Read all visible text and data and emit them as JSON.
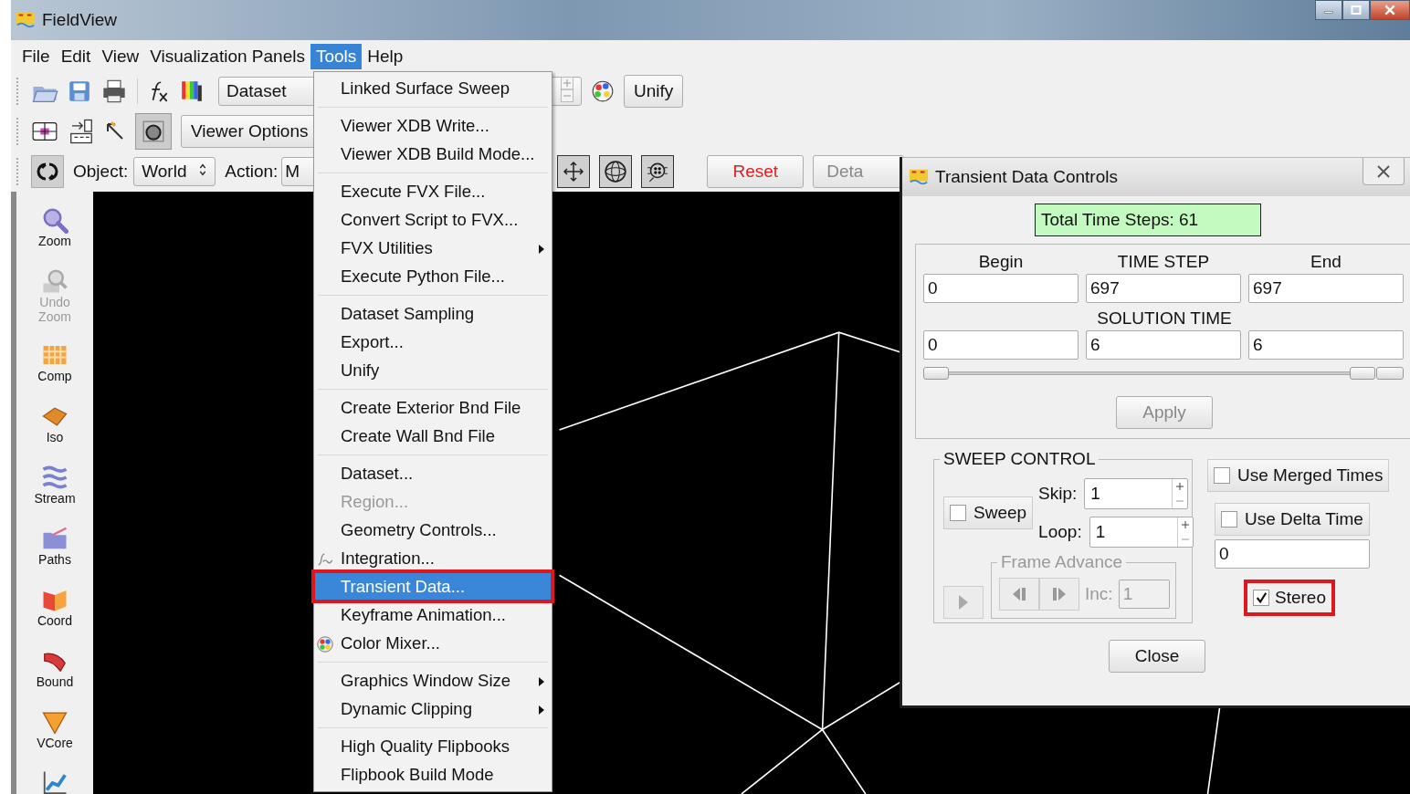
{
  "window": {
    "title": "FieldView"
  },
  "menubar": [
    {
      "label": "File",
      "selected": false
    },
    {
      "label": "Edit",
      "selected": false
    },
    {
      "label": "View",
      "selected": false
    },
    {
      "label": "Visualization Panels",
      "selected": false
    },
    {
      "label": "Tools",
      "selected": true
    },
    {
      "label": "Help",
      "selected": false
    }
  ],
  "toolbar_1": {
    "dataset_select": "Dataset",
    "unify_button": "Unify"
  },
  "toolbar_2": {
    "viewer_options_button": "Viewer Options"
  },
  "toolbar_3": {
    "object_label": "Object:",
    "object_value": "World",
    "action_label": "Action:",
    "action_value": "M",
    "reset_button": "Reset",
    "detach_button": "Deta"
  },
  "sidebar": {
    "items": [
      {
        "kind": "zoom",
        "label": "Zoom",
        "disabled": false
      },
      {
        "kind": "undo",
        "label": "Undo Zoom",
        "disabled": true
      },
      {
        "kind": "separator"
      },
      {
        "kind": "comp",
        "label": "Comp",
        "disabled": false
      },
      {
        "kind": "iso",
        "label": "Iso",
        "disabled": false
      },
      {
        "kind": "stream",
        "label": "Stream",
        "disabled": false
      },
      {
        "kind": "paths",
        "label": "Paths",
        "disabled": false
      },
      {
        "kind": "coord",
        "label": "Coord",
        "disabled": false
      },
      {
        "kind": "bound",
        "label": "Bound",
        "disabled": false
      },
      {
        "kind": "vcore",
        "label": "VCore",
        "disabled": false
      },
      {
        "kind": "chart"
      }
    ]
  },
  "tools_menu": {
    "items": [
      {
        "kind": "plain",
        "label": "Linked Surface Sweep",
        "disabled": false,
        "selected": false,
        "submenu": false
      },
      {
        "kind": "separator"
      },
      {
        "kind": "plain",
        "label": "Viewer XDB Write...",
        "disabled": false,
        "selected": false,
        "submenu": false
      },
      {
        "kind": "plain",
        "label": "Viewer XDB Build Mode...",
        "disabled": false,
        "selected": false,
        "submenu": false
      },
      {
        "kind": "separator"
      },
      {
        "kind": "plain",
        "label": "Execute FVX File...",
        "disabled": false,
        "selected": false,
        "submenu": false
      },
      {
        "kind": "plain",
        "label": "Convert Script to FVX...",
        "disabled": false,
        "selected": false,
        "submenu": false
      },
      {
        "kind": "plain",
        "label": "FVX Utilities",
        "disabled": false,
        "selected": false,
        "submenu": true
      },
      {
        "kind": "plain",
        "label": "Execute Python File...",
        "disabled": false,
        "selected": false,
        "submenu": false
      },
      {
        "kind": "separator"
      },
      {
        "kind": "plain",
        "label": "Dataset Sampling",
        "disabled": false,
        "selected": false,
        "submenu": false
      },
      {
        "kind": "plain",
        "label": "Export...",
        "disabled": false,
        "selected": false,
        "submenu": false
      },
      {
        "kind": "plain",
        "label": "Unify",
        "disabled": false,
        "selected": false,
        "submenu": false
      },
      {
        "kind": "separator"
      },
      {
        "kind": "plain",
        "label": "Create Exterior Bnd File",
        "disabled": false,
        "selected": false,
        "submenu": false
      },
      {
        "kind": "plain",
        "label": "Create Wall Bnd File",
        "disabled": false,
        "selected": false,
        "submenu": false
      },
      {
        "kind": "separator"
      },
      {
        "kind": "plain",
        "label": "Dataset...",
        "disabled": false,
        "selected": false,
        "submenu": false
      },
      {
        "kind": "plain",
        "label": "Region...",
        "disabled": true,
        "selected": false,
        "submenu": false
      },
      {
        "kind": "plain",
        "label": "Geometry Controls...",
        "disabled": false,
        "selected": false,
        "submenu": false
      },
      {
        "kind": "integral",
        "label": "Integration...",
        "disabled": false,
        "selected": false,
        "submenu": false
      },
      {
        "kind": "plain",
        "label": "Transient Data...",
        "disabled": false,
        "selected": true,
        "highlighted": true,
        "submenu": false
      },
      {
        "kind": "plain",
        "label": "Keyframe Animation...",
        "disabled": false,
        "selected": false,
        "submenu": false
      },
      {
        "kind": "palette",
        "label": "Color Mixer...",
        "disabled": false,
        "selected": false,
        "submenu": false
      },
      {
        "kind": "separator"
      },
      {
        "kind": "plain",
        "label": "Graphics Window Size",
        "disabled": false,
        "selected": false,
        "submenu": true
      },
      {
        "kind": "plain",
        "label": "Dynamic Clipping",
        "disabled": false,
        "selected": false,
        "submenu": true
      },
      {
        "kind": "separator"
      },
      {
        "kind": "plain",
        "label": "High Quality Flipbooks",
        "disabled": false,
        "selected": false,
        "submenu": false
      },
      {
        "kind": "plain",
        "label": "Flipbook Build Mode",
        "disabled": false,
        "selected": false,
        "submenu": false
      }
    ]
  },
  "dialog": {
    "title": "Transient Data Controls",
    "total_steps": "Total Time Steps:  61",
    "column_labels": [
      "Begin",
      "TIME STEP",
      "End"
    ],
    "time_step_values": [
      "0",
      "697",
      "697"
    ],
    "solution_time_label": "SOLUTION TIME",
    "solution_time_values": [
      "0",
      "6",
      "6"
    ],
    "range_slider": {
      "level": 1
    },
    "apply_button": {
      "label": "Apply",
      "disabled": true
    },
    "sweep_control": {
      "title": "SWEEP CONTROL",
      "sweep": {
        "label": "Sweep",
        "checked": false
      },
      "skip_label": "Skip:",
      "skip_value": "1",
      "loop_label": "Loop:",
      "loop_value": "1",
      "frame_advance": {
        "title": "Frame Advance",
        "disabled": true,
        "inc_label": "Inc:",
        "inc_value": "1"
      }
    },
    "use_merged_times": {
      "label": "Use Merged Times",
      "checked": false
    },
    "use_delta_time": {
      "label": "Use Delta Time",
      "checked": false
    },
    "delta_value": "0",
    "stereo": {
      "label": "Stereo",
      "checked": true,
      "highlighted": true
    },
    "close_button": "Close"
  }
}
